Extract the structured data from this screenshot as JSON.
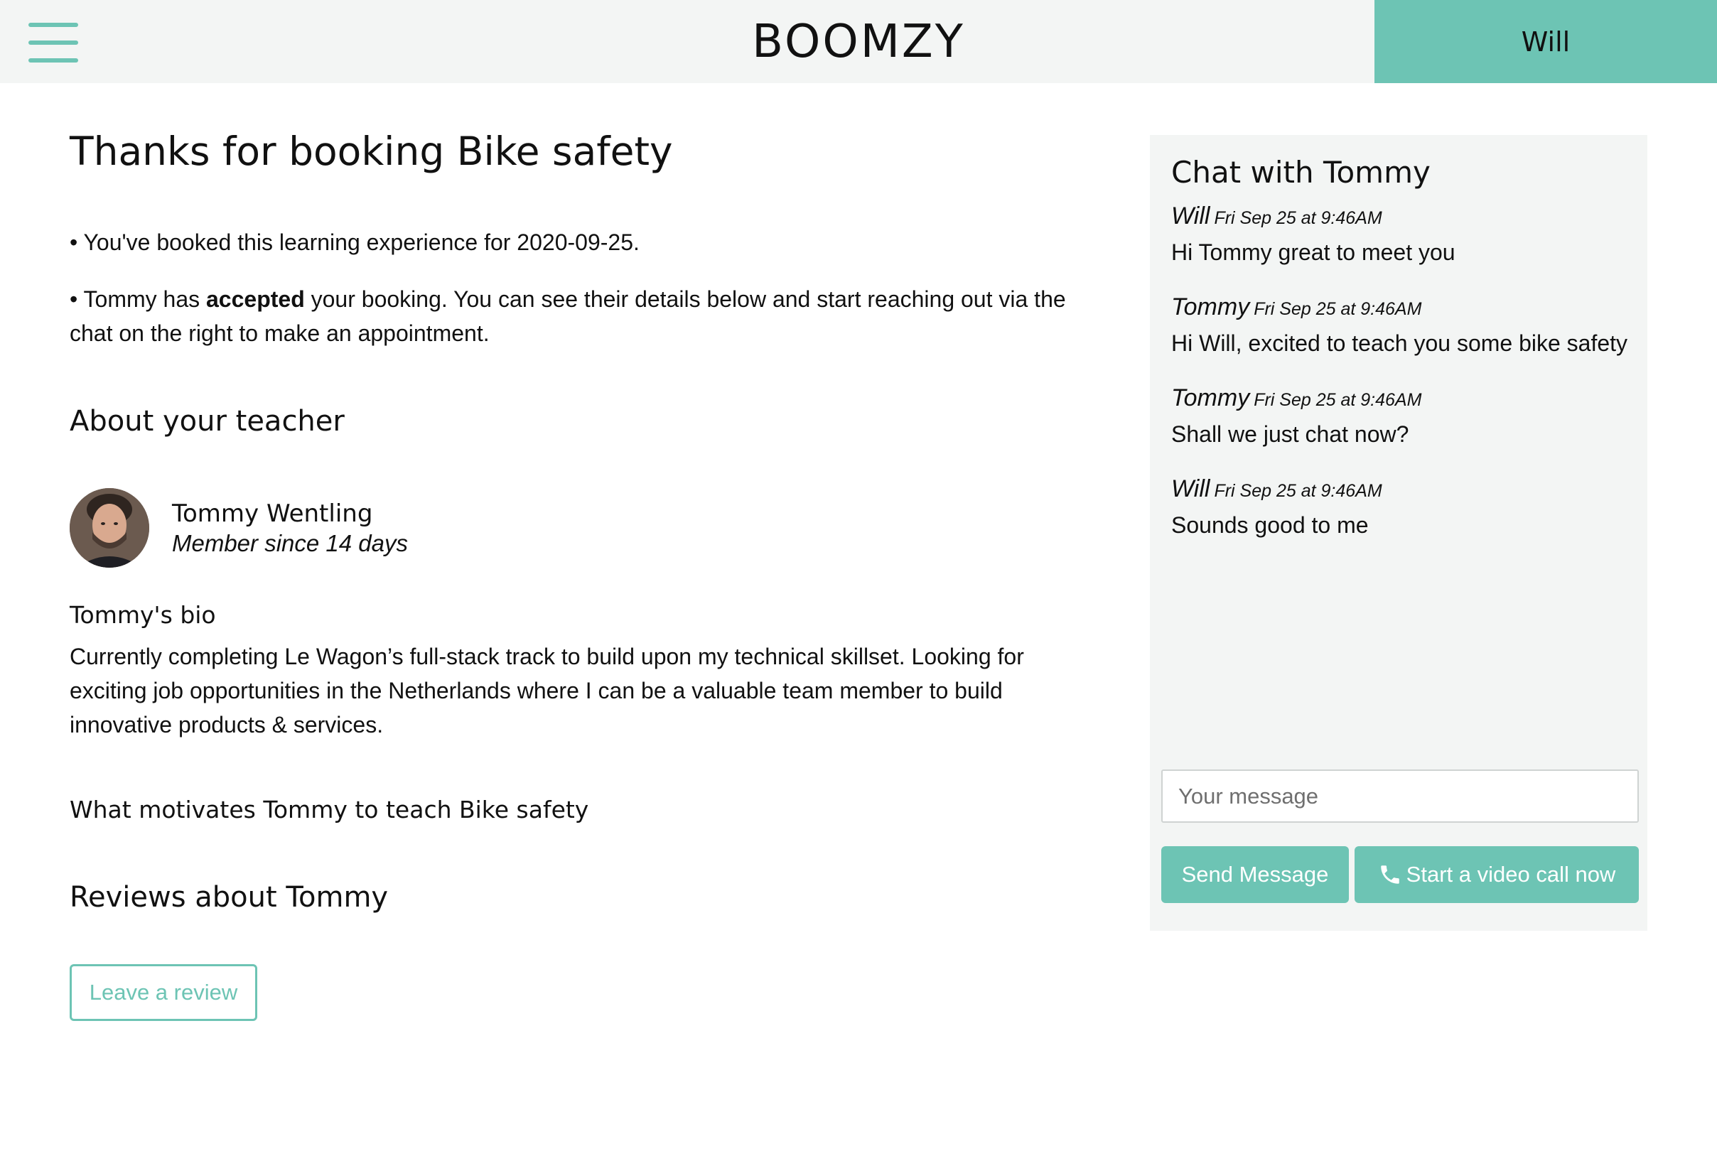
{
  "header": {
    "brand": "BOOMZY",
    "user_name": "Will"
  },
  "main": {
    "title": "Thanks for booking Bike safety",
    "booking_line": "• You've booked this learning experience for 2020-09-25.",
    "accepted_prefix": "• Tommy has ",
    "accepted_bold": "accepted",
    "accepted_suffix": " your booking. You can see their details below and start reaching out via the chat on the right to make an appointment.",
    "about_heading": "About your teacher",
    "teacher": {
      "name": "Tommy Wentling",
      "member_since": "Member since 14 days"
    },
    "bio_heading": "Tommy's bio",
    "bio_text": "Currently completing Le Wagon’s full-stack track to build upon my technical skillset. Looking for exciting job opportunities in the Netherlands where I can be a valuable team member to build innovative products & services.",
    "motivation_heading": "What motivates Tommy to teach Bike safety",
    "reviews_heading": "Reviews about Tommy",
    "leave_review_label": "Leave a review"
  },
  "chat": {
    "title": "Chat with Tommy",
    "messages": [
      {
        "author": "Will",
        "time": "Fri Sep 25 at 9:46AM",
        "text": "Hi Tommy great to meet you"
      },
      {
        "author": "Tommy",
        "time": "Fri Sep 25 at 9:46AM",
        "text": "Hi Will, excited to teach you some bike safety"
      },
      {
        "author": "Tommy",
        "time": "Fri Sep 25 at 9:46AM",
        "text": "Shall we just chat now?"
      },
      {
        "author": "Will",
        "time": "Fri Sep 25 at 9:46AM",
        "text": "Sounds good to me"
      }
    ],
    "input_placeholder": "Your message",
    "send_label": "Send Message",
    "video_label": "Start a video call now"
  },
  "colors": {
    "accent": "#6dc4b4",
    "header_bg": "#f3f5f4",
    "panel_bg": "#f3f5f4"
  },
  "icons": {
    "menu": "hamburger-menu-icon",
    "phone": "phone-icon"
  }
}
